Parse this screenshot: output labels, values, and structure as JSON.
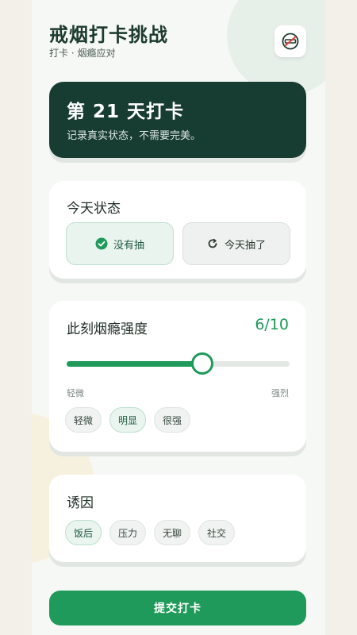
{
  "header": {
    "title": "戒烟打卡挑战",
    "subtitle": "打卡 · 烟瘾应对",
    "icon": "no-smoking-icon"
  },
  "hero": {
    "title": "第 21 天打卡",
    "subtitle": "记录真实状态，不需要完美。"
  },
  "status": {
    "title": "今天状态",
    "options": [
      {
        "label": "没有抽",
        "icon": "check-circle-icon",
        "selected": true
      },
      {
        "label": "今天抽了",
        "icon": "refresh-icon",
        "selected": false
      }
    ]
  },
  "intensity": {
    "title": "此刻烟瘾强度",
    "value_text": "6/10",
    "value": 6,
    "max": 10,
    "min_label": "轻微",
    "max_label": "强烈",
    "presets": [
      "轻微",
      "明显",
      "很强"
    ],
    "active_preset": 1
  },
  "triggers": {
    "title": "诱因",
    "items": [
      "饭后",
      "压力",
      "无聊",
      "社交"
    ],
    "active_index": 0
  },
  "submit_label": "提交打卡",
  "colors": {
    "accent": "#1f9a5a",
    "hero_bg": "#173c32",
    "page_bg": "#f6f8f6"
  }
}
